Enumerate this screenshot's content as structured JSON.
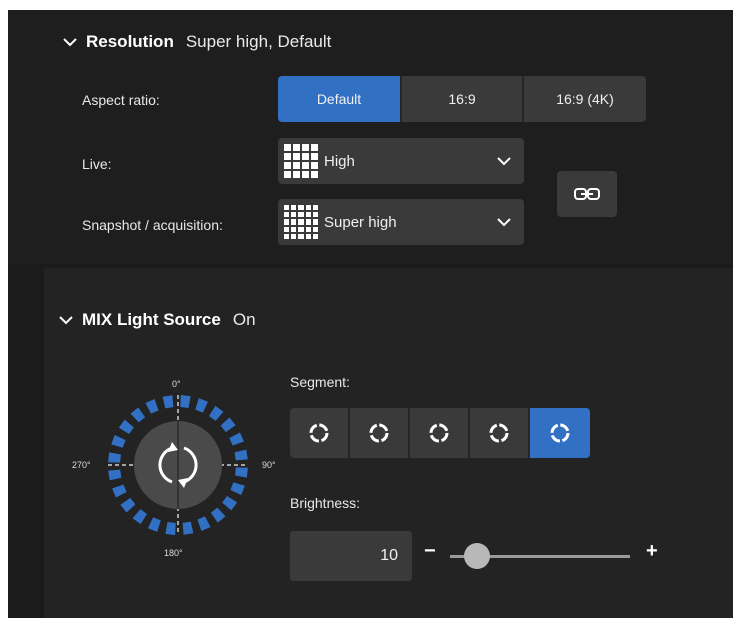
{
  "resolution": {
    "title": "Resolution",
    "summary": "Super high, Default",
    "aspect_label": "Aspect ratio:",
    "aspect_options": [
      "Default",
      "16:9",
      "16:9 (4K)"
    ],
    "aspect_selected": "Default",
    "live_label": "Live:",
    "live_value": "High",
    "snapshot_label": "Snapshot / acquisition:",
    "snapshot_value": "Super high"
  },
  "mix": {
    "title": "MIX Light Source",
    "state": "On",
    "dial": {
      "top": "0°",
      "right": "90°",
      "bottom": "180°",
      "left": "270°"
    },
    "segment_label": "Segment:",
    "segment_count": 5,
    "segment_selected_index": 4,
    "brightness_label": "Brightness:",
    "brightness_value": "10",
    "minus": "−",
    "plus": "+",
    "brightness_fraction": 0.15
  },
  "colors": {
    "accent": "#3270c4",
    "panel": "#1e1e1e",
    "control": "#3a3a3a"
  },
  "icons": [
    "chevron-down-icon",
    "grid-icon",
    "link-icon",
    "segment-ring-icon",
    "rotate-icon"
  ]
}
